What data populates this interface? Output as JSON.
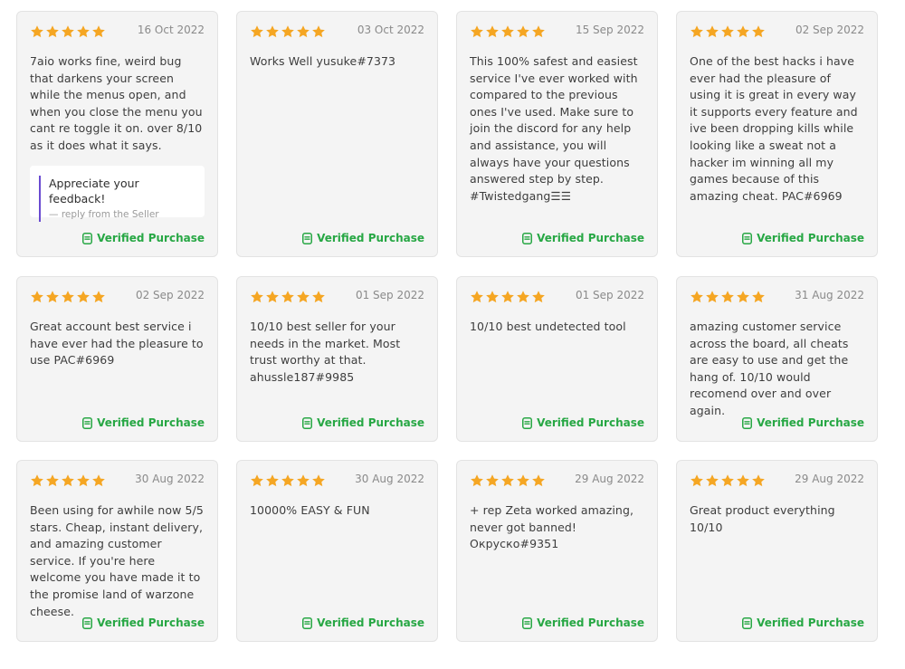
{
  "colors": {
    "star": "#f5a623",
    "verified": "#27a744",
    "reply_accent": "#6a4bd1"
  },
  "icons": {
    "star": "star-icon",
    "verified": "receipt-check-icon"
  },
  "verified_label": "Verified Purchase",
  "reviews": [
    {
      "rating": 5,
      "date": "16 Oct 2022",
      "text": "7aio works fine, weird bug that darkens your screen while the menus open, and when you close the menu you cant re toggle it on. over 8/10 as it does what it says.",
      "reply": {
        "text": "Appreciate your feedback!",
        "meta": "— reply from the Seller"
      }
    },
    {
      "rating": 5,
      "date": "03 Oct 2022",
      "text": "Works Well yusuke#7373"
    },
    {
      "rating": 5,
      "date": "15 Sep 2022",
      "text": "This 100% safest and easiest service I've ever worked with compared to the previous ones I've used. Make sure to join the discord for any help and assistance, you will always have your questions answered step by step. #Twistedgang☰☰"
    },
    {
      "rating": 5,
      "date": "02 Sep 2022",
      "text": "One of the best hacks i have ever had the pleasure of using it is great in every way it supports every feature and ive been dropping kills while looking like a sweat not a hacker im winning all my games because of this amazing cheat. PAC#6969"
    },
    {
      "rating": 5,
      "date": "02 Sep 2022",
      "text": "Great account best service i have ever had the pleasure to use PAC#6969"
    },
    {
      "rating": 5,
      "date": "01 Sep 2022",
      "text": "10/10 best seller for your needs in the market. Most trust worthy at that. ahussle187#9985"
    },
    {
      "rating": 5,
      "date": "01 Sep 2022",
      "text": "10/10 best undetected tool"
    },
    {
      "rating": 5,
      "date": "31 Aug 2022",
      "text": "amazing customer service across the board, all cheats are easy to use and get the hang of. 10/10 would recomend over and over again."
    },
    {
      "rating": 5,
      "date": "30 Aug 2022",
      "text": "Been using for awhile now 5/5 stars. Cheap, instant delivery, and amazing customer service. If you're here welcome you have made it to the promise land of warzone cheese."
    },
    {
      "rating": 5,
      "date": "30 Aug 2022",
      "text": "10000% EASY & FUN"
    },
    {
      "rating": 5,
      "date": "29 Aug 2022",
      "text": "+ rep Zeta worked amazing, never got banned! Окруско#9351"
    },
    {
      "rating": 5,
      "date": "29 Aug 2022",
      "text": "Great product everything 10/10"
    }
  ]
}
